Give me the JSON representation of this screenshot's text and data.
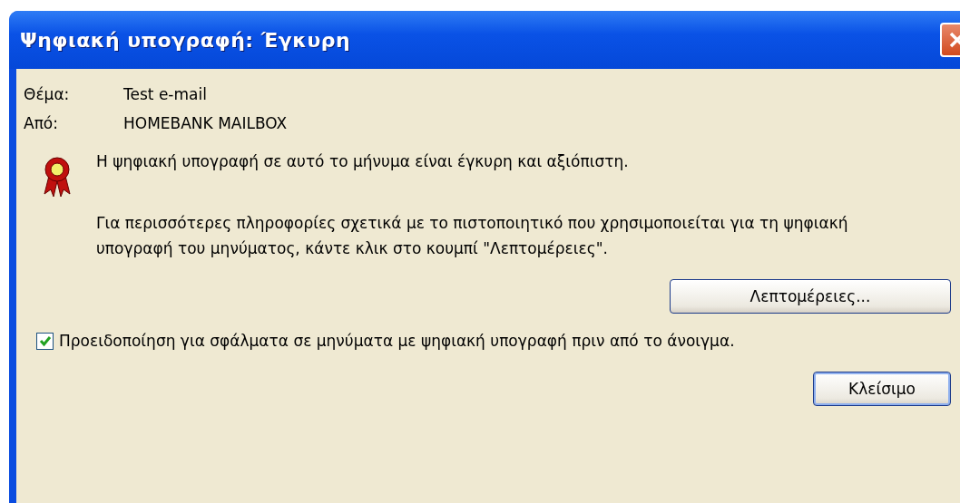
{
  "window": {
    "title": "Ψηφιακή υπογραφή: Έγκυρη"
  },
  "fields": [
    {
      "label": "Θέμα:",
      "value": "Test e-mail"
    },
    {
      "label": "Από:",
      "value": "HOMEBANK MAILBOX"
    }
  ],
  "status_message": "Η ψηφιακή υπογραφή σε αυτό το μήνυμα είναι έγκυρη και αξιόπιστη.",
  "info_message": "Για περισσότερες πληροφορίες σχετικά με το πιστοποιητικό που χρησιμοποιείται για τη ψηφιακή υπογραφή του μηνύματος, κάντε κλικ στο κουμπί \"Λεπτομέρειες\".",
  "details_button": "Λεπτομέρειες...",
  "warn_checkbox": {
    "label": "Προειδοποίηση για σφάλματα σε μηνύματα με ψηφιακή υπογραφή πριν από το άνοιγμα.",
    "checked": true
  },
  "close_button": "Κλείσιμο"
}
